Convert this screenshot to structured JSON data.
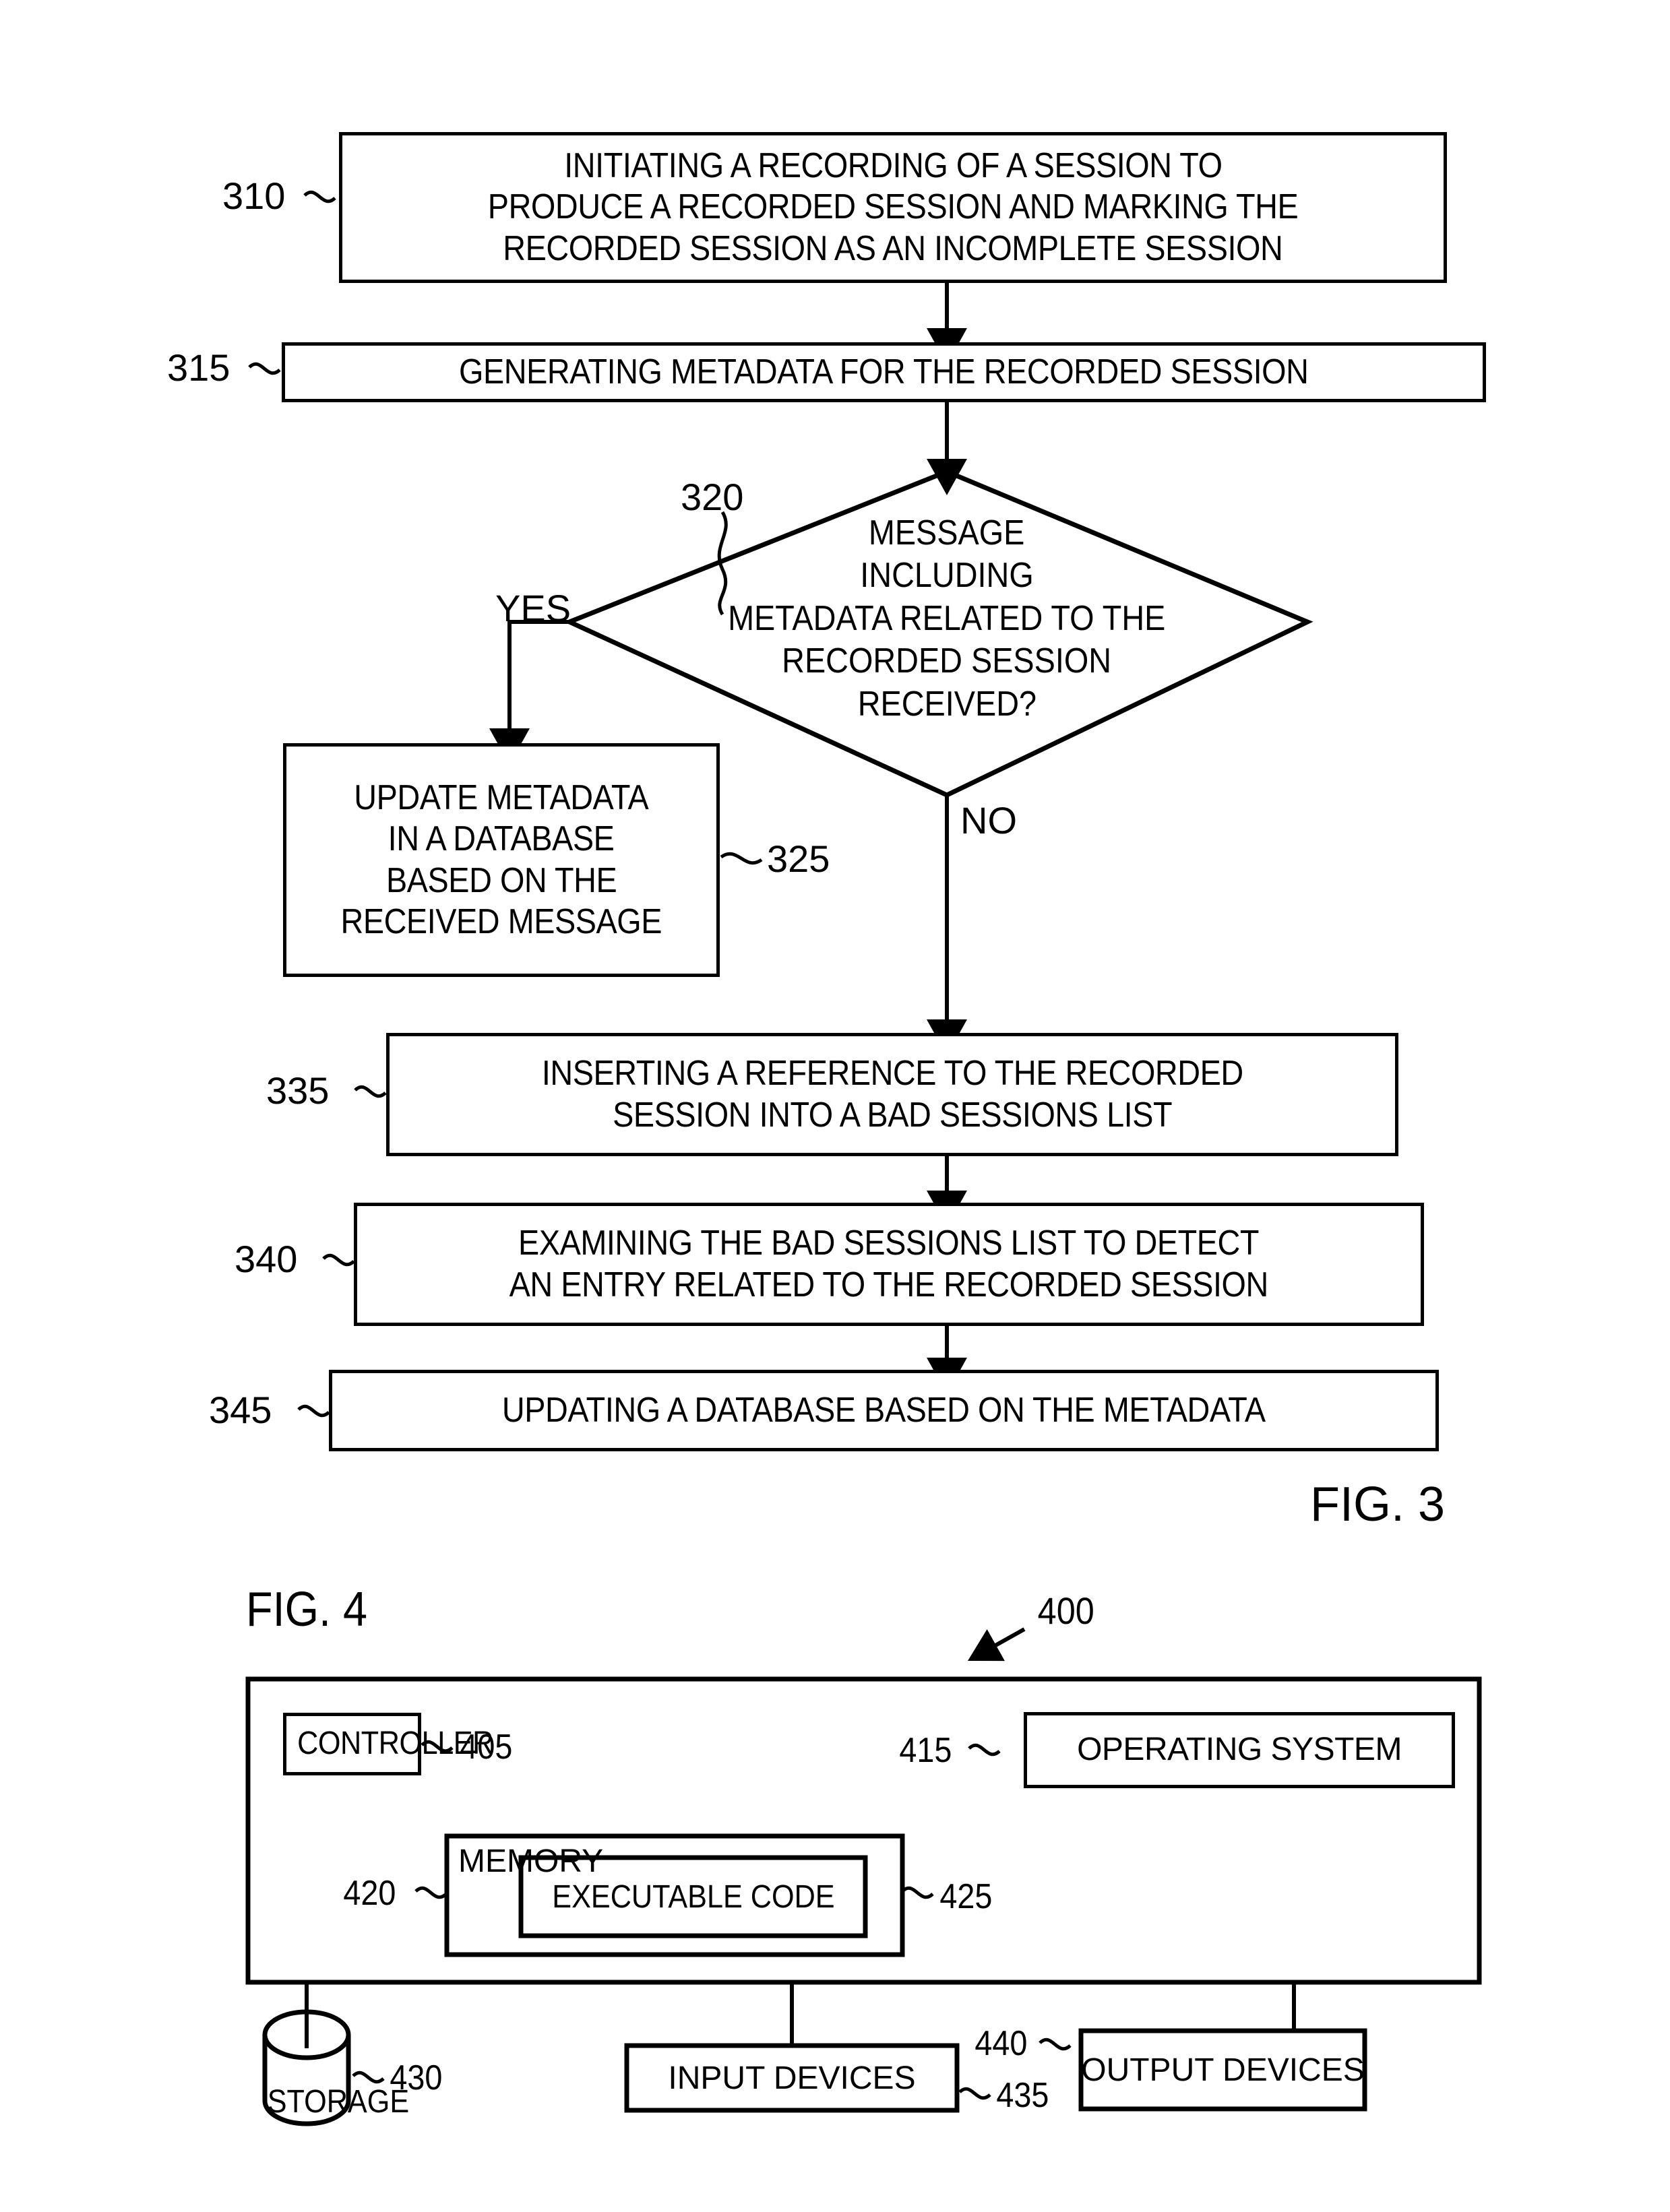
{
  "figures": [
    {
      "caption": "FIG. 3",
      "nodes": [
        {
          "ref": "310",
          "kind": "process",
          "lines": [
            "INITIATING A RECORDING OF A SESSION TO",
            "PRODUCE A RECORDED SESSION AND MARKING THE",
            "RECORDED SESSION AS AN INCOMPLETE SESSION"
          ]
        },
        {
          "ref": "315",
          "kind": "process",
          "lines": [
            "GENERATING METADATA FOR THE RECORDED SESSION"
          ]
        },
        {
          "ref": "320",
          "kind": "decision",
          "lines": [
            "MESSAGE",
            "INCLUDING",
            "METADATA RELATED TO THE",
            "RECORDED SESSION",
            "RECEIVED?"
          ]
        },
        {
          "ref": "325",
          "kind": "process",
          "lines": [
            "UPDATE METADATA",
            "IN A DATABASE",
            "BASED ON THE",
            "RECEIVED MESSAGE"
          ]
        },
        {
          "ref": "335",
          "kind": "process",
          "lines": [
            "INSERTING A REFERENCE TO THE RECORDED",
            "SESSION INTO A BAD SESSIONS LIST"
          ]
        },
        {
          "ref": "340",
          "kind": "process",
          "lines": [
            "EXAMINING THE BAD SESSIONS LIST TO DETECT",
            "AN ENTRY RELATED TO THE RECORDED SESSION"
          ]
        },
        {
          "ref": "345",
          "kind": "process",
          "lines": [
            "UPDATING A DATABASE BASED ON THE METADATA"
          ]
        }
      ],
      "branch_labels": {
        "yes": "YES",
        "no": "NO"
      }
    },
    {
      "caption": "FIG. 4",
      "ref": "400",
      "nodes": [
        {
          "ref": "405",
          "label": "CONTROLLER"
        },
        {
          "ref": "415",
          "label": "OPERATING SYSTEM"
        },
        {
          "ref": "420",
          "label": "MEMORY"
        },
        {
          "ref": "425",
          "label": "EXECUTABLE CODE"
        },
        {
          "ref": "430",
          "label": "STORAGE"
        },
        {
          "ref": "435",
          "label": "INPUT DEVICES"
        },
        {
          "ref": "440",
          "label": "OUTPUT DEVICES"
        }
      ]
    }
  ],
  "fig3": {
    "caption": "FIG. 3",
    "box310": {
      "ref": "310",
      "line1": "INITIATING A RECORDING OF A SESSION TO",
      "line2": "PRODUCE A RECORDED SESSION AND MARKING THE",
      "line3": "RECORDED SESSION AS AN INCOMPLETE SESSION"
    },
    "box315": {
      "ref": "315",
      "line1": "GENERATING METADATA FOR THE RECORDED SESSION"
    },
    "diamond320": {
      "ref": "320",
      "line1": "MESSAGE",
      "line2": "INCLUDING",
      "line3": "METADATA RELATED TO THE",
      "line4": "RECORDED SESSION",
      "line5": "RECEIVED?"
    },
    "box325": {
      "ref": "325",
      "line1": "UPDATE METADATA",
      "line2": "IN A DATABASE",
      "line3": "BASED ON THE",
      "line4": "RECEIVED MESSAGE"
    },
    "box335": {
      "ref": "335",
      "line1": "INSERTING A REFERENCE TO THE RECORDED",
      "line2": "SESSION INTO A BAD SESSIONS LIST"
    },
    "box340": {
      "ref": "340",
      "line1": "EXAMINING THE BAD SESSIONS LIST TO DETECT",
      "line2": "AN ENTRY RELATED TO THE RECORDED SESSION"
    },
    "box345": {
      "ref": "345",
      "line1": "UPDATING A DATABASE BASED ON THE METADATA"
    },
    "yes_label": "YES",
    "no_label": "NO"
  },
  "fig4": {
    "caption": "FIG. 4",
    "system_ref": "400",
    "controller": {
      "ref": "405",
      "label": "CONTROLLER"
    },
    "operating_system": {
      "ref": "415",
      "label": "OPERATING SYSTEM"
    },
    "memory": {
      "ref": "420",
      "label": "MEMORY"
    },
    "executable_code": {
      "ref": "425",
      "label": "EXECUTABLE CODE"
    },
    "storage": {
      "ref": "430",
      "label": "STORAGE"
    },
    "input_devices": {
      "ref": "435",
      "label": "INPUT DEVICES"
    },
    "output_devices": {
      "ref": "440",
      "label": "OUTPUT DEVICES"
    }
  },
  "colors": {
    "ink": "#000000",
    "paper": "#ffffff"
  }
}
